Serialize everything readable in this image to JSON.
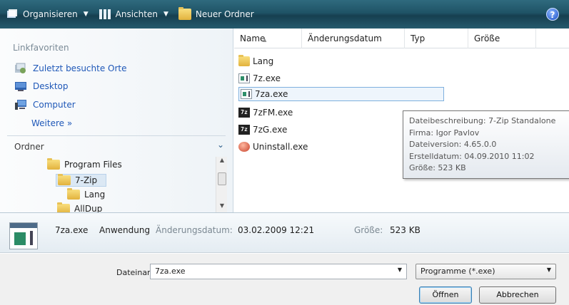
{
  "toolbar": {
    "organize_label": "Organisieren",
    "views_label": "Ansichten",
    "new_folder_label": "Neuer Ordner",
    "help_label": "?"
  },
  "nav": {
    "favorites_heading": "Linkfavoriten",
    "favorites": [
      {
        "label": "Zuletzt besuchte Orte",
        "icon": "recent-places-icon"
      },
      {
        "label": "Desktop",
        "icon": "desktop-icon"
      },
      {
        "label": "Computer",
        "icon": "computer-icon"
      }
    ],
    "more_label": "Weitere »",
    "folders_heading": "Ordner",
    "tree": [
      {
        "label": "Program Files",
        "level": 0
      },
      {
        "label": "7-Zip",
        "level": 1,
        "selected": true
      },
      {
        "label": "Lang",
        "level": 2
      },
      {
        "label": "AllDup",
        "level": 1
      }
    ]
  },
  "columns": [
    "Name",
    "Änderungsdatum",
    "Typ",
    "Größe"
  ],
  "files": [
    {
      "name": "Lang",
      "icon": "folder-icon"
    },
    {
      "name": "7z.exe",
      "icon": "exe-icon"
    },
    {
      "name": "7za.exe",
      "icon": "exe-icon",
      "focused": true
    },
    {
      "name": "7zFM.exe",
      "icon": "7zip-icon"
    },
    {
      "name": "7zG.exe",
      "icon": "7zip-icon"
    },
    {
      "name": "Uninstall.exe",
      "icon": "uninstall-icon"
    }
  ],
  "tooltip": [
    "Dateibeschreibung: 7-Zip Standalone",
    "Firma: Igor Pavlov",
    "Dateiversion: 4.65.0.0",
    "Erstelldatum: 04.09.2010 11:02",
    "Größe: 523 KB"
  ],
  "details": {
    "filename": "7za.exe",
    "type": "Anwendung",
    "modified_label": "Änderungsdatum:",
    "modified_value": "03.02.2009 12:21",
    "size_label": "Größe:",
    "size_value": "523 KB"
  },
  "form": {
    "filename_label": "Dateiname:",
    "filename_value": "7za.exe",
    "filetype_value": "Programme (*.exe)",
    "open_label": "Öffnen",
    "cancel_label": "Abbrechen"
  }
}
